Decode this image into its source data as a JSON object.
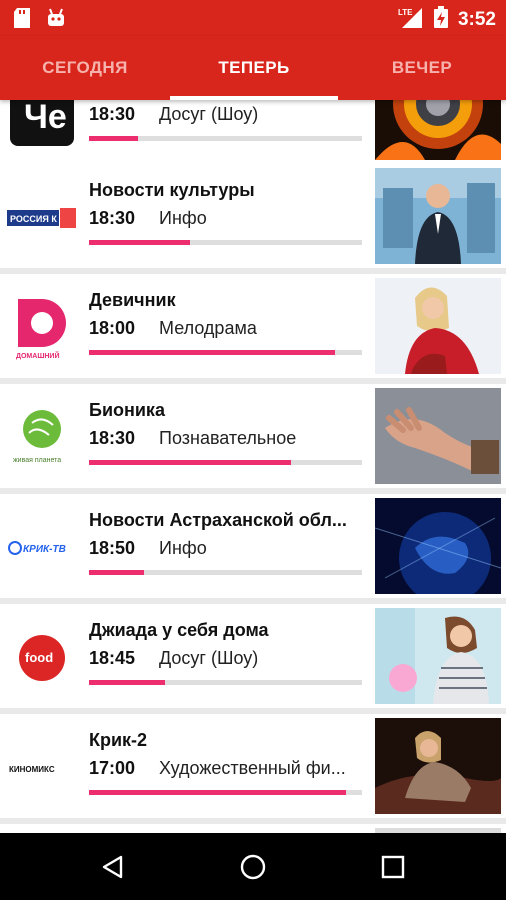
{
  "status_bar": {
    "time": "3:52",
    "network": "LTE",
    "left_icons": [
      "sd-card-icon",
      "android-icon"
    ],
    "right_icons": [
      "signal-icon",
      "battery-charging-icon"
    ]
  },
  "tabs": [
    {
      "label": "СЕГОДНЯ",
      "active": false
    },
    {
      "label": "ТЕПЕРЬ",
      "active": true
    },
    {
      "label": "ВЕЧЕР",
      "active": false
    }
  ],
  "programs": [
    {
      "channel": "Че",
      "title": "",
      "time": "18:30",
      "genre": "Досуг (Шоу)",
      "progress": 0.18
    },
    {
      "channel": "РОССИЯ К",
      "title": "Новости культуры",
      "time": "18:30",
      "genre": "Инфо",
      "progress": 0.37
    },
    {
      "channel": "ДОМАШНИЙ",
      "title": "Девичник",
      "time": "18:00",
      "genre": "Мелодрама",
      "progress": 0.9
    },
    {
      "channel": "живая планета",
      "title": "Бионика",
      "time": "18:30",
      "genre": "Познавательное",
      "progress": 0.74
    },
    {
      "channel": "КРИК-ТВ",
      "title": "Новости Астраханской обл...",
      "time": "18:50",
      "genre": "Инфо",
      "progress": 0.2
    },
    {
      "channel": "food",
      "title": "Джиада у себя дома",
      "time": "18:45",
      "genre": "Досуг (Шоу)",
      "progress": 0.28
    },
    {
      "channel": "КИНОМИКС",
      "title": "Крик-2",
      "time": "17:00",
      "genre": "Художественный фи...",
      "progress": 0.94
    }
  ],
  "colors": {
    "primary": "#d9261c",
    "progress": "#ec2e6e",
    "track": "#dedede"
  },
  "nav": [
    "back-icon",
    "home-icon",
    "recents-icon"
  ]
}
